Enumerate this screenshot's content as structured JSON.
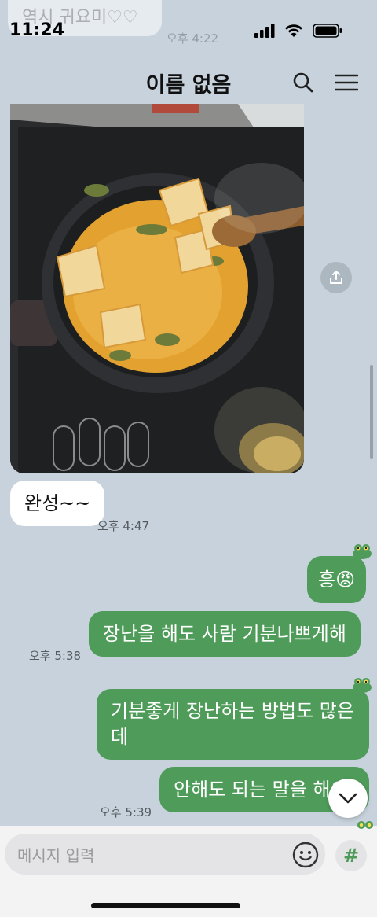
{
  "status_bar": {
    "time": "11:24"
  },
  "ghost_message": {
    "text": "역시 귀요미♡♡",
    "time": "오후 4:22"
  },
  "header": {
    "title": "이름 없음",
    "icons": [
      "search-icon",
      "menu-icon"
    ]
  },
  "messages": [
    {
      "side": "in",
      "text": "완성~~",
      "time": "오후 4:47"
    },
    {
      "side": "out",
      "text": "흥😡"
    },
    {
      "side": "out",
      "text": "장난을 해도 사람 기분나쁘게해",
      "time": "오후 5:38"
    },
    {
      "side": "out",
      "lines": [
        "기분좋게 장난하는 방법도 많은",
        "데"
      ]
    },
    {
      "side": "out",
      "text": "안해도 되는 말을 해요",
      "time": "오후 5:39"
    }
  ],
  "composer": {
    "placeholder": "메시지 입력",
    "hash_label": "#"
  },
  "colors": {
    "background": "#c7d2dc",
    "outgoing": "#4f9c5a",
    "incoming": "#ffffff"
  }
}
